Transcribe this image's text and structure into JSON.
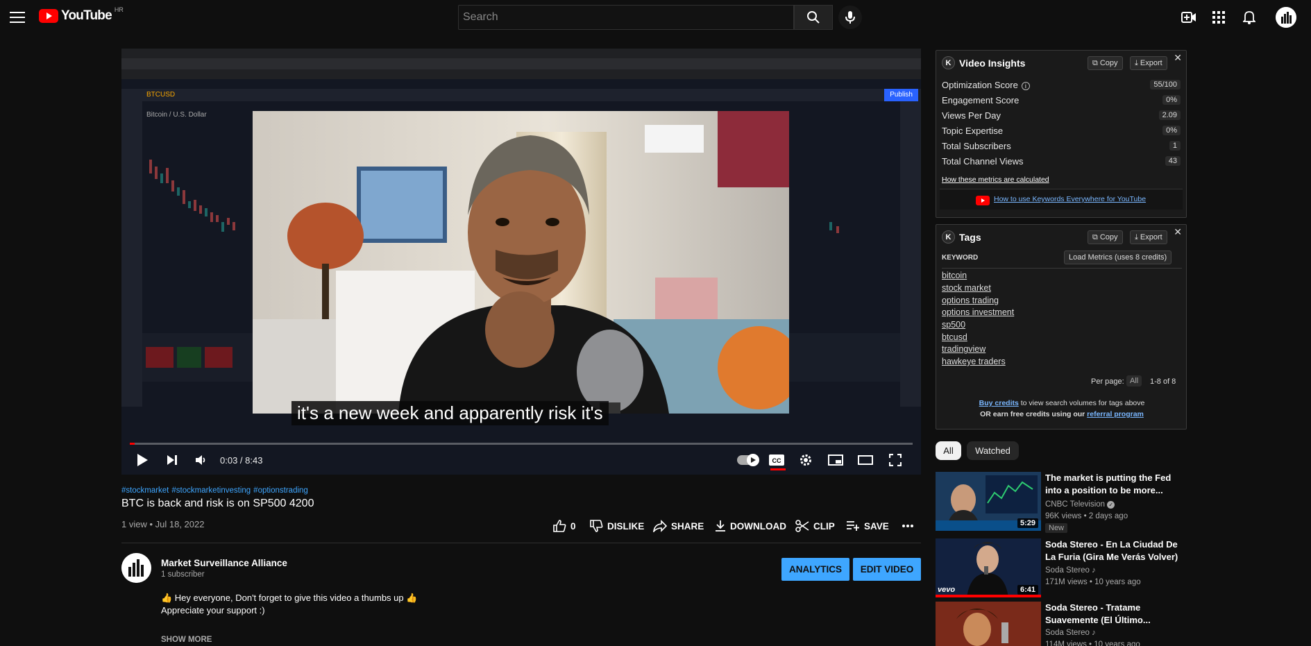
{
  "masthead": {
    "logo_text": "YouTube",
    "country_code": "HR",
    "search_placeholder": "Search"
  },
  "player": {
    "caption": "it's a new week and apparently risk it's",
    "current_time": "0:03",
    "duration": "8:43",
    "time_display": "0:03 / 8:43",
    "progress_fraction": 0.006,
    "chart_background_labels": {
      "symbol": "BTCUSD",
      "pair_title": "Bitcoin / U.S. Dollar",
      "publish": "Publish"
    }
  },
  "video": {
    "hashtags": [
      "#stockmarket",
      "#stockmarketinvesting",
      "#optionstrading"
    ],
    "title": "BTC is back and risk is on SP500 4200",
    "meta": "1 view • Jul 18, 2022",
    "likes": "0",
    "dislike_label": "DISLIKE",
    "share_label": "SHARE",
    "download_label": "DOWNLOAD",
    "clip_label": "CLIP",
    "save_label": "SAVE"
  },
  "channel": {
    "name": "Market Surveillance Alliance",
    "subscribers": "1 subscriber",
    "analytics_label": "ANALYTICS",
    "edit_label": "EDIT VIDEO",
    "description_line1": "👍 Hey everyone, Don't forget to give this video a thumbs up 👍",
    "description_line2": "Appreciate your support :)",
    "show_more": "SHOW MORE"
  },
  "insights": {
    "title": "Video Insights",
    "copy_label": "Copy",
    "export_label": "Export",
    "metrics": [
      {
        "label": "Optimization Score",
        "value": "55/100"
      },
      {
        "label": "Engagement Score",
        "value": "0%"
      },
      {
        "label": "Views Per Day",
        "value": "2.09"
      },
      {
        "label": "Topic Expertise",
        "value": "0%"
      },
      {
        "label": "Total Subscribers",
        "value": "1"
      },
      {
        "label": "Total Channel Views",
        "value": "43"
      }
    ],
    "how_link": "How these metrics are calculated",
    "keywords_link": "How to use Keywords Everywhere for YouTube"
  },
  "tags": {
    "title": "Tags",
    "copy_label": "Copy",
    "export_label": "Export",
    "keyword_header": "KEYWORD",
    "load_metrics": "Load Metrics (uses 8 credits)",
    "keywords": [
      "bitcoin",
      "stock market",
      "options trading",
      "options investment",
      "sp500",
      "btcusd",
      "tradingview",
      "hawkeye traders"
    ],
    "per_page_label": "Per page:",
    "per_page_value": "All",
    "range": "1-8 of 8",
    "buy_credits": "Buy credits",
    "buy_rest": " to view search volumes for tags above",
    "earn_prefix": "OR earn free credits using our ",
    "referral": "referral program"
  },
  "chips": {
    "all": "All",
    "watched": "Watched"
  },
  "recommendations": [
    {
      "title": "The market is putting the Fed into a position to be more...",
      "channel": "CNBC Television",
      "meta": "96K views • 2 days ago",
      "duration": "5:29",
      "badge": "New"
    },
    {
      "title": "Soda Stereo - En La Ciudad De La Furia (Gira Me Verás Volver)",
      "channel": "Soda Stereo",
      "meta": "171M views • 10 years ago",
      "duration": "6:41",
      "thumb_label": "vevo"
    },
    {
      "title": "Soda Stereo - Tratame Suavemente (El Último...",
      "channel": "Soda Stereo",
      "meta": "114M views • 10 years ago"
    }
  ],
  "colors": {
    "accent_red": "#ff0000",
    "link_blue": "#3ea6ff",
    "background": "#0f0f0f"
  }
}
